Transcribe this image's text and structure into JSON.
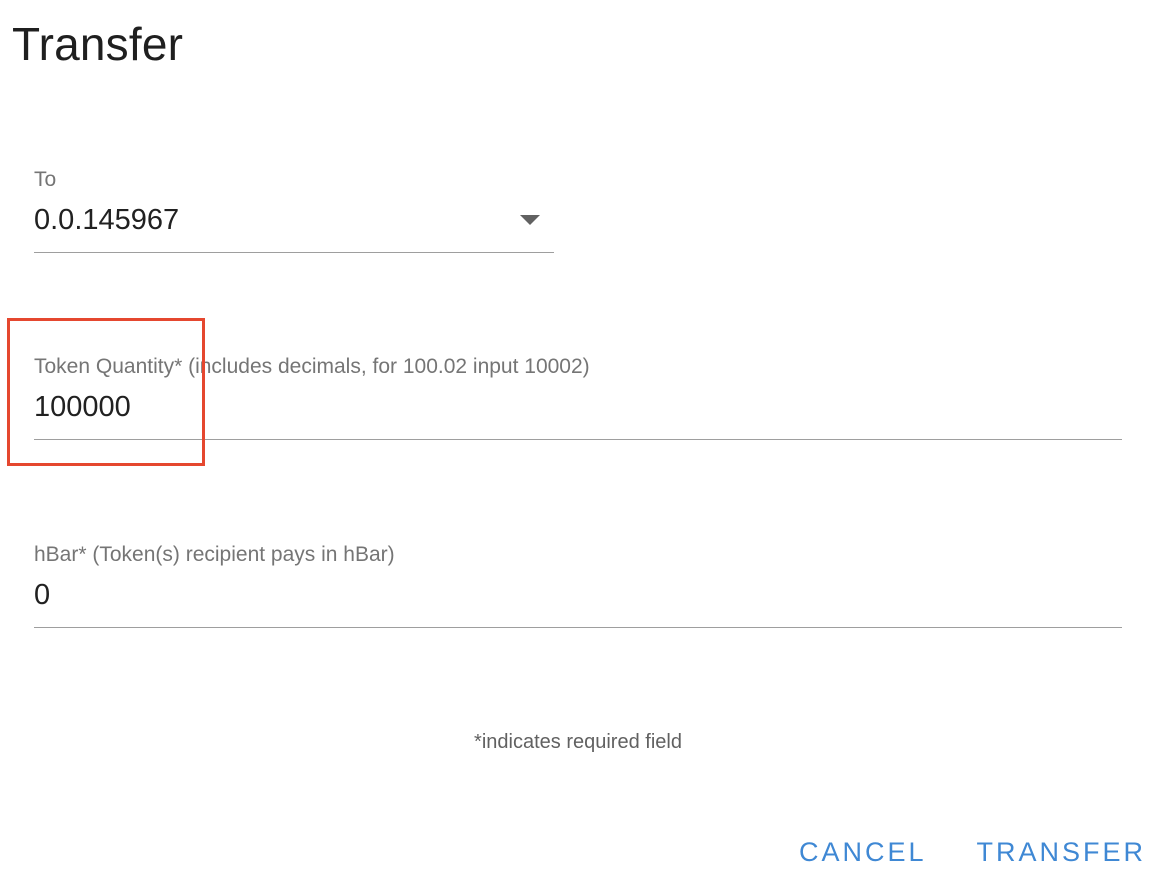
{
  "dialog": {
    "title": "Transfer"
  },
  "fields": {
    "to": {
      "label": "To",
      "value": "0.0.145967"
    },
    "token_quantity": {
      "label": "Token Quantity* (includes decimals, for 100.02 input 10002)",
      "value": "100000"
    },
    "hbar": {
      "label": "hBar* (Token(s) recipient pays in hBar)",
      "value": "0"
    }
  },
  "footer": {
    "required_note": "*indicates required field"
  },
  "actions": {
    "cancel_label": "CANCEL",
    "transfer_label": "TRANSFER"
  },
  "icons": {
    "dropdown": "dropdown-arrow-icon"
  },
  "colors": {
    "accent": "#3f88d4",
    "highlight": "#e5472f"
  }
}
